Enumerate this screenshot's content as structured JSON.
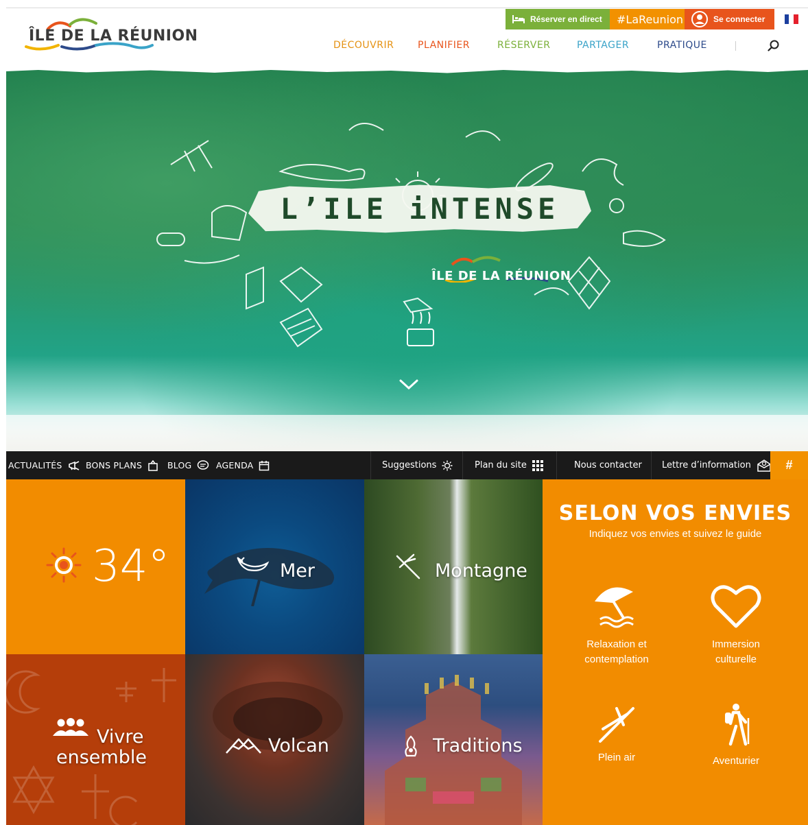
{
  "header": {
    "logo": {
      "alt": "ÎLE DE LA RÉUNION"
    },
    "topbar": {
      "reserve_label": "Réserver en direct",
      "hashtag_label": "#LaReunion",
      "login_label": "Se connecter",
      "language": "FR"
    },
    "nav": [
      {
        "label": "DÉCOUVRIR",
        "color": "#e59213"
      },
      {
        "label": "PLANIFIER",
        "color": "#e8541c"
      },
      {
        "label": "RÉSERVER",
        "color": "#7bb03a"
      },
      {
        "label": "PARTAGER",
        "color": "#3aa3c8"
      },
      {
        "label": "PRATIQUE",
        "color": "#2c4a8a"
      }
    ]
  },
  "hero": {
    "title": "L’ILE iNTENSE",
    "brand": "ÎLE DE LA RÉUNION"
  },
  "subbar": {
    "left": [
      {
        "label": "ACTUALITÉS",
        "icon": "megaphone-icon"
      },
      {
        "label": "BONS PLANS",
        "icon": "bag-icon"
      },
      {
        "label": "BLOG",
        "icon": "chat-icon"
      },
      {
        "label": "AGENDA",
        "icon": "calendar-icon"
      }
    ],
    "right": [
      {
        "label": "Suggestions",
        "icon": "sun-icon"
      },
      {
        "label": "Plan du site",
        "icon": "grid-icon"
      },
      {
        "label": "Nous contacter"
      },
      {
        "label": "Lettre d’information",
        "icon": "newsletter-icon"
      }
    ],
    "hash_label": "#"
  },
  "tiles": {
    "weather": {
      "temperature": "34°"
    },
    "mer": {
      "label": "Mer"
    },
    "montagne": {
      "label": "Montagne"
    },
    "vivre": {
      "label_line1": "Vivre",
      "label_line2": "ensemble"
    },
    "volcan": {
      "label": "Volcan"
    },
    "traditions": {
      "label": "Traditions"
    }
  },
  "envies": {
    "title": "SELON VOS ENVIES",
    "subtitle": "Indiquez vos envies et suivez le guide",
    "options": [
      {
        "label_line1": "Relaxation et",
        "label_line2": "contemplation",
        "icon": "beach-umbrella-icon"
      },
      {
        "label_line1": "Immersion",
        "label_line2": "culturelle",
        "icon": "heart-icon"
      },
      {
        "label_line1": "Plein air",
        "label_line2": "",
        "icon": "paraglider-icon"
      },
      {
        "label_line1": "Aventurier",
        "label_line2": "",
        "icon": "hiker-icon"
      }
    ]
  },
  "colors": {
    "orange": "#f28c00",
    "green": "#7bb03a",
    "red_orange": "#e8541c",
    "dark_bar": "#1a1a1a",
    "rust": "#b53e0a"
  }
}
